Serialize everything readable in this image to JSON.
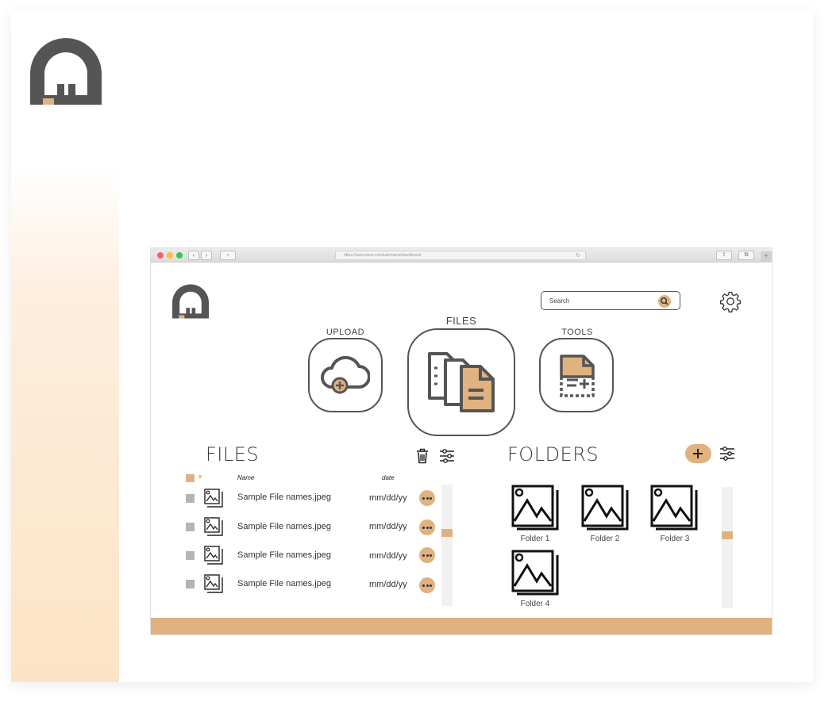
{
  "colors": {
    "accent": "#dfb280",
    "dark": "#555555",
    "check_gray": "#b4b4b4"
  },
  "browser": {
    "url": "https://www.mine.com/username/dashboard"
  },
  "search": {
    "placeholder": "Search"
  },
  "nav": {
    "upload_label": "UPLOAD",
    "files_label": "FILES",
    "tools_label": "TOOLS"
  },
  "files": {
    "title": "FILES",
    "col_name": "Name",
    "col_date": "date",
    "rows": [
      {
        "name": "Sample File names.jpeg",
        "date": "mm/dd/yy"
      },
      {
        "name": "Sample File names.jpeg",
        "date": "mm/dd/yy"
      },
      {
        "name": "Sample File names.jpeg",
        "date": "mm/dd/yy"
      },
      {
        "name": "Sample File names.jpeg",
        "date": "mm/dd/yy"
      }
    ]
  },
  "folders": {
    "title": "FOLDERS",
    "items": [
      {
        "label": "Folder 1"
      },
      {
        "label": "Folder 2"
      },
      {
        "label": "Folder 3"
      },
      {
        "label": "Folder 4"
      }
    ]
  },
  "icons": [
    "brand-logo-icon",
    "search-icon",
    "gear-icon",
    "cloud-upload-icon",
    "files-icon",
    "tools-icon",
    "trash-icon",
    "sliders-icon",
    "image-file-icon",
    "more-icon",
    "plus-icon",
    "folder-image-icon"
  ]
}
